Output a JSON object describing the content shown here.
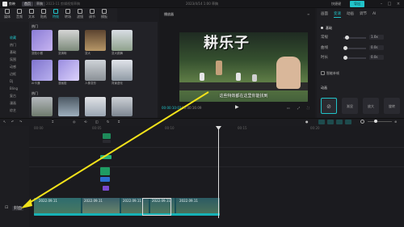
{
  "titlebar": {
    "app_name": "剪映",
    "tabs": [
      "首页",
      "草稿"
    ],
    "draft_info": "2023-11 剪辑视频草稿",
    "project_title": "2023/4/14 1:00 草稿",
    "shortcut_label": "快捷键",
    "export_label": "导出"
  },
  "toolbar": {
    "tools": [
      {
        "label": "媒体",
        "icon": "media-icon"
      },
      {
        "label": "音频",
        "icon": "audio-icon"
      },
      {
        "label": "文本",
        "icon": "text-icon"
      },
      {
        "label": "贴纸",
        "icon": "sticker-icon"
      },
      {
        "label": "特效",
        "icon": "effects-icon"
      },
      {
        "label": "转场",
        "icon": "transition-icon"
      },
      {
        "label": "滤镜",
        "icon": "filter-icon"
      },
      {
        "label": "调节",
        "icon": "adjust-icon"
      },
      {
        "label": "模板",
        "icon": "template-icon"
      }
    ]
  },
  "leftnav": {
    "items": [
      "收藏",
      "热门",
      "基础",
      "氛围",
      "动感",
      "边框",
      "Dj",
      "Bling",
      "复古",
      "漫画",
      "综艺",
      "扭曲"
    ]
  },
  "media": {
    "section_title": "热门",
    "section2_title": "热门",
    "items": [
      {
        "label": "变脸小猴"
      },
      {
        "label": "变清晰"
      },
      {
        "label": "变大"
      },
      {
        "label": "变大跳舞"
      },
      {
        "label": "AI卡通"
      },
      {
        "label": "漫画脸"
      },
      {
        "label": "人像变形"
      },
      {
        "label": "背景虚化"
      }
    ]
  },
  "player": {
    "title": "播放器",
    "video_caption_big": "耕乐子",
    "video_subtitle": "这些特效都在这里你能找到",
    "time_current": "00:00:10:03",
    "time_total": "00:00:16:09"
  },
  "rightpanel": {
    "tabs": [
      "画面",
      "变速",
      "动画",
      "调节",
      "AI"
    ],
    "active_tab": "变速",
    "section_basic": "基础",
    "rows": [
      {
        "label": "常规",
        "value": "1.0x"
      },
      {
        "label": "曲线",
        "value": "0.0s"
      },
      {
        "label": "时长",
        "value": "0.0s"
      }
    ],
    "smart_label": "智能补帧",
    "anim_section": "动画",
    "anim_cards": [
      "无",
      "渐显",
      "放大",
      "旋转"
    ]
  },
  "timeline": {
    "main_track_label": "封面",
    "clip_labels": [
      "2022.09.11",
      "2022.09.11",
      "2022.09.11",
      "2022.09.11",
      "2022.09.11"
    ],
    "ruler_labels": [
      "00:00",
      "00:05",
      "00:10",
      "00:15",
      "00:20"
    ]
  },
  "colors": {
    "accent": "#21c3c9",
    "annotation_arrow": "#f2e21a"
  }
}
